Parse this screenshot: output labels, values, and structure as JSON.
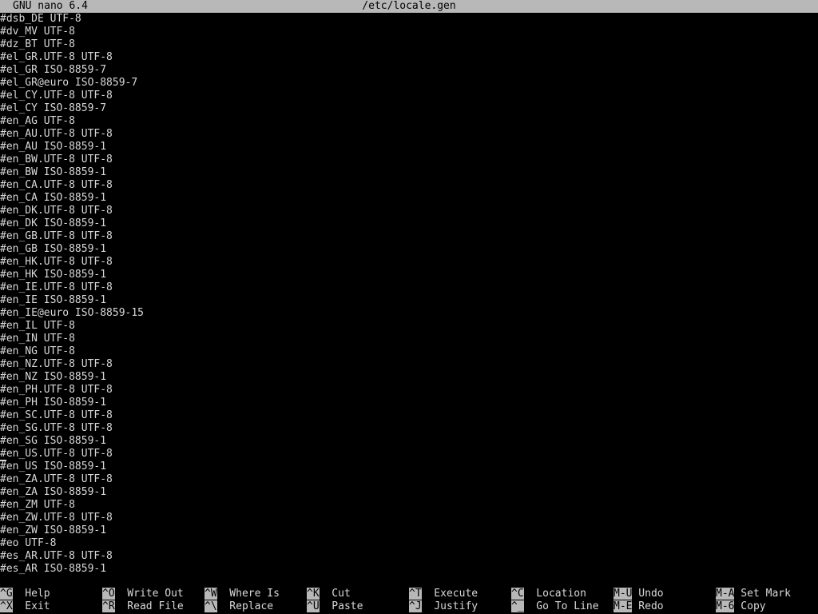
{
  "title_bar": {
    "app": "GNU nano 6.4",
    "filename": "/etc/locale.gen"
  },
  "buffer": {
    "cursor_line": 34,
    "lines": [
      "#dsb_DE UTF-8",
      "#dv_MV UTF-8",
      "#dz_BT UTF-8",
      "#el_GR.UTF-8 UTF-8",
      "#el_GR ISO-8859-7",
      "#el_GR@euro ISO-8859-7",
      "#el_CY.UTF-8 UTF-8",
      "#el_CY ISO-8859-7",
      "#en_AG UTF-8",
      "#en_AU.UTF-8 UTF-8",
      "#en_AU ISO-8859-1",
      "#en_BW.UTF-8 UTF-8",
      "#en_BW ISO-8859-1",
      "#en_CA.UTF-8 UTF-8",
      "#en_CA ISO-8859-1",
      "#en_DK.UTF-8 UTF-8",
      "#en_DK ISO-8859-1",
      "#en_GB.UTF-8 UTF-8",
      "#en_GB ISO-8859-1",
      "#en_HK.UTF-8 UTF-8",
      "#en_HK ISO-8859-1",
      "#en_IE.UTF-8 UTF-8",
      "#en_IE ISO-8859-1",
      "#en_IE@euro ISO-8859-15",
      "#en_IL UTF-8",
      "#en_IN UTF-8",
      "#en_NG UTF-8",
      "#en_NZ.UTF-8 UTF-8",
      "#en_NZ ISO-8859-1",
      "#en_PH.UTF-8 UTF-8",
      "#en_PH ISO-8859-1",
      "#en_SC.UTF-8 UTF-8",
      "#en_SG.UTF-8 UTF-8",
      "#en_SG ISO-8859-1",
      "#en_US.UTF-8 UTF-8",
      "#en_US ISO-8859-1",
      "#en_ZA.UTF-8 UTF-8",
      "#en_ZA ISO-8859-1",
      "#en_ZM UTF-8",
      "#en_ZW.UTF-8 UTF-8",
      "#en_ZW ISO-8859-1",
      "#eo UTF-8",
      "#es_AR.UTF-8 UTF-8",
      "#es_AR ISO-8859-1"
    ]
  },
  "shortcuts": {
    "row1": [
      {
        "key": "^G",
        "label": "Help"
      },
      {
        "key": "^O",
        "label": "Write Out"
      },
      {
        "key": "^W",
        "label": "Where Is"
      },
      {
        "key": "^K",
        "label": "Cut"
      },
      {
        "key": "^T",
        "label": "Execute"
      },
      {
        "key": "^C",
        "label": "Location"
      },
      {
        "key": "M-U",
        "label": "Undo"
      },
      {
        "key": "M-A",
        "label": "Set Mark"
      }
    ],
    "row2": [
      {
        "key": "^X",
        "label": "Exit"
      },
      {
        "key": "^R",
        "label": "Read File"
      },
      {
        "key": "^\\",
        "label": "Replace"
      },
      {
        "key": "^U",
        "label": "Paste"
      },
      {
        "key": "^J",
        "label": "Justify"
      },
      {
        "key": "^_",
        "label": "Go To Line"
      },
      {
        "key": "M-E",
        "label": "Redo"
      },
      {
        "key": "M-6",
        "label": "Copy"
      }
    ]
  }
}
